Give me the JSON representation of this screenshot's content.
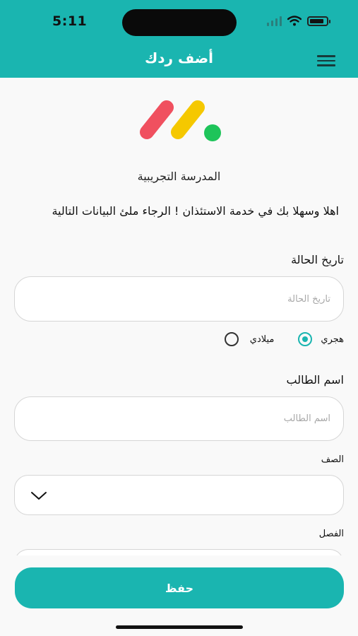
{
  "status_bar": {
    "time": "5:11",
    "battery_level": 0.85,
    "icons": [
      "signal-icon",
      "wifi-icon",
      "battery-icon"
    ]
  },
  "header": {
    "title": "أضف ردك",
    "menu_icon": "hamburger-menu-icon"
  },
  "colors": {
    "accent": "#1ab5b0",
    "logo_red": "#f0505f",
    "logo_yellow": "#f5c800",
    "logo_green": "#1ec45a"
  },
  "school_name": "المدرسة التجريبية",
  "welcome_text": "اهلا وسهلا بك في خدمة الاستئذان ! الرجاء ملئ البيانات التالية",
  "form": {
    "case_date": {
      "label": "تاريخ الحالة",
      "placeholder": "تاريخ الحالة",
      "value": ""
    },
    "calendar": {
      "options": [
        {
          "label": "هجري",
          "selected": true
        },
        {
          "label": "ميلادي",
          "selected": false
        }
      ]
    },
    "student_name": {
      "label": "اسم الطالب",
      "placeholder": "اسم الطالب",
      "value": ""
    },
    "grade": {
      "label": "الصف",
      "value": ""
    },
    "section": {
      "label": "الفصل"
    }
  },
  "actions": {
    "save_label": "حفظ"
  }
}
